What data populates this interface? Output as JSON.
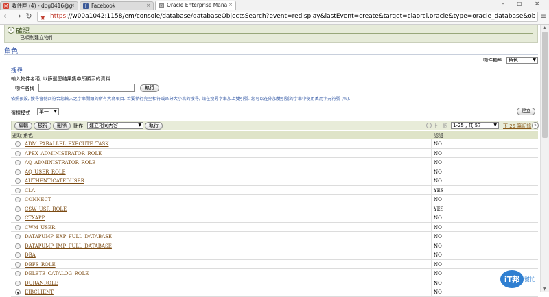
{
  "browser": {
    "tabs": [
      {
        "label": "收件匣 (4) - dog0416@g",
        "icon": "gmail-icon",
        "icon_glyph": "M",
        "icon_color": "#d23f31",
        "active": false
      },
      {
        "label": "Facebook",
        "icon": "facebook-icon",
        "icon_glyph": "f",
        "icon_color": "#3b5998",
        "active": false
      },
      {
        "label": "Oracle Enterprise Mana",
        "icon": "page-icon",
        "icon_glyph": "▫",
        "icon_color": "#888888",
        "active": true
      }
    ],
    "window_controls": "– ▢ ✕",
    "url_scheme": "https",
    "url_rest": "://w00a1042:1158/em/console/database/databaseObjectsSearch?event=redisplay&lastEvent=create&target=claorcl.oracle&type=oracle_database&ob"
  },
  "confirmation": {
    "title": "確認",
    "message": "已順利建立物件"
  },
  "page": {
    "title": "角色",
    "object_type_label": "物件類型",
    "object_type_value": "角色"
  },
  "search": {
    "title": "搜尋",
    "instruction": "輸入物件名稱, 以篩選您結果集中所顯示的資料",
    "object_name_label": "物件名稱",
    "object_name_value": "",
    "go_label": "執行",
    "note": "依照預設, 搜尋會傳回符合您輸入之字串開頭的所有大寫項目. 若要執行完全相符或區分大小寫的搜尋, 請在搜尋字串加上雙引號. 您可以在外加雙引號的字串中使用萬用字元符號 (%)."
  },
  "selection": {
    "mode_label": "選擇模式",
    "mode_value": "單一",
    "create_label": "建立"
  },
  "actions": {
    "edit_label": "編輯",
    "view_label": "檢視",
    "delete_label": "刪除",
    "action_label": "動作",
    "action_value": "建立相同內容",
    "go_label": "執行",
    "prev_label": "上一個",
    "range_value": "1-25 , 共 57",
    "next_label": "下 25 筆記錄"
  },
  "table": {
    "columns": {
      "select": "選取",
      "role": "角色",
      "authentication": "認證"
    },
    "rows": [
      {
        "role": "ADM_PARALLEL_EXECUTE_TASK",
        "auth": "NO",
        "selected": false
      },
      {
        "role": "APEX_ADMINISTRATOR_ROLE",
        "auth": "NO",
        "selected": false
      },
      {
        "role": "AQ_ADMINISTRATOR_ROLE",
        "auth": "NO",
        "selected": false
      },
      {
        "role": "AQ_USER_ROLE",
        "auth": "NO",
        "selected": false
      },
      {
        "role": "AUTHENTICATEDUSER",
        "auth": "NO",
        "selected": false
      },
      {
        "role": "CLA",
        "auth": "YES",
        "selected": false
      },
      {
        "role": "CONNECT",
        "auth": "NO",
        "selected": false
      },
      {
        "role": "CSW_USR_ROLE",
        "auth": "YES",
        "selected": false
      },
      {
        "role": "CTXAPP",
        "auth": "NO",
        "selected": false
      },
      {
        "role": "CWM_USER",
        "auth": "NO",
        "selected": false
      },
      {
        "role": "DATAPUMP_EXP_FULL_DATABASE",
        "auth": "NO",
        "selected": false
      },
      {
        "role": "DATAPUMP_IMP_FULL_DATABASE",
        "auth": "NO",
        "selected": false
      },
      {
        "role": "DBA",
        "auth": "NO",
        "selected": false
      },
      {
        "role": "DBFS_ROLE",
        "auth": "NO",
        "selected": false
      },
      {
        "role": "DELETE_CATALOG_ROLE",
        "auth": "NO",
        "selected": false
      },
      {
        "role": "DURANROLE",
        "auth": "NO",
        "selected": false
      },
      {
        "role": "EJBCLIENT",
        "auth": "NO",
        "selected": true
      }
    ]
  },
  "watermark": {
    "main": "iT邦",
    "sub": "幫忙"
  }
}
